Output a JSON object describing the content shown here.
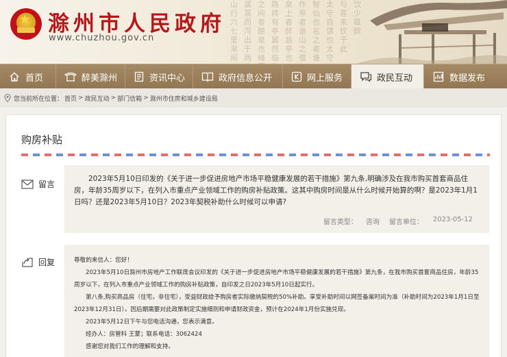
{
  "header": {
    "site_title": "滁州市人民政府",
    "site_url": "www.chuzhou.gov.cn"
  },
  "nav": {
    "items": [
      {
        "label": "首页",
        "icon": "home-icon"
      },
      {
        "label": "醉美滁州",
        "icon": "pavilion-icon"
      },
      {
        "label": "资讯中心",
        "icon": "document-icon"
      },
      {
        "label": "政府信息公开",
        "icon": "book-icon"
      },
      {
        "label": "网上服务",
        "icon": "service-icon"
      },
      {
        "label": "政民互动",
        "icon": "chat-icon",
        "active": true
      },
      {
        "label": "数据发布",
        "icon": "data-icon"
      }
    ]
  },
  "breadcrumb": {
    "prefix": "您当前所在位置：",
    "items": [
      "首页",
      "政民互动",
      "部门信箱",
      "滁州市住房和城乡建设局"
    ],
    "separator": ">"
  },
  "page": {
    "title": "购房补贴"
  },
  "message": {
    "label": "留言",
    "text": "2023年5月10日印发的《关于进一步促进房地产市场平稳健康发展的若干措施》第九条,明确涉及在我市购买首套商品住房，年龄35周岁以下，在列入市重点产业领域工作的购房补贴政策。这其中购房时间是从什么时候开始算的啊？是2023年1月1日吗？还是2023年5月10日？2023年契税补助什么时候可以申请?",
    "type_label": "留言类型：",
    "type_value": "咨询",
    "unit_label": "留言单位：",
    "date": "2023-05-12"
  },
  "reply": {
    "label": "回复",
    "greeting": "尊敬的来信人：您好！",
    "p1": "2023年5月10日滁州市房地产工作联席会议印发的《关于进一步促进房地产市场平稳健康发展的若干措施》第九条，在我市购买首套商品住房，年龄35周岁以下，在列入市重点产业领域工作的购房补贴政策，自印发之日2023年5月10日起实行。",
    "p2": "第八条,购买商品房（住宅，非住宅），受益财政给予购房者实际缴纳契税的50%补助。享受补助时间以网签备案时间为准（补助时间为2023年1月1日至2023年12月31日）。因后期需要对此政策制定实施细则和申请财政资金，预计在2024年1月份实施兑现。",
    "p3": "2023年5月12日下午与您电话沟通，您表示满意。",
    "p4": "经办人：房管科  王蒙；联系电话：3062424",
    "p5": "感谢您对我们工作的理解和支持。"
  },
  "colors": {
    "brand_red": "#b5181a",
    "nav_bg": "#9c805c",
    "panel_bg": "#f3efe9"
  }
}
